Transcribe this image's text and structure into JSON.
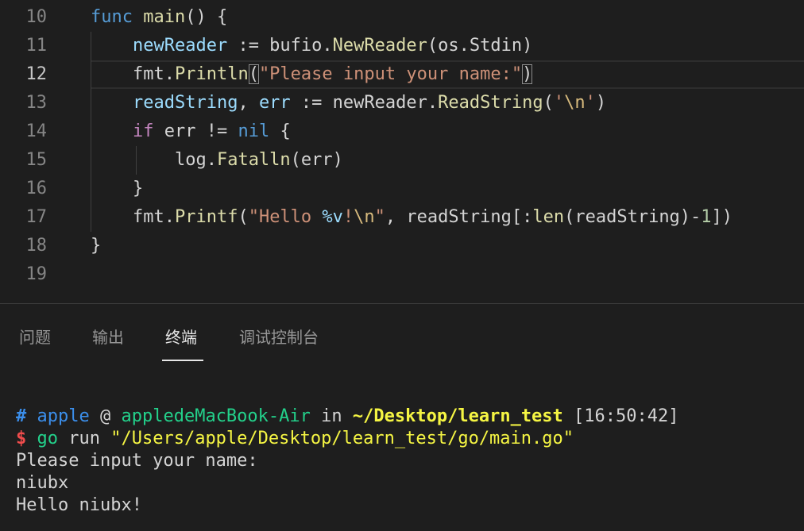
{
  "editor": {
    "lines": [
      {
        "num": "10",
        "indent": "",
        "tokens": [
          {
            "t": "func",
            "c": "#569cd6"
          },
          {
            "t": " ",
            "c": "#d4d4d4"
          },
          {
            "t": "main",
            "c": "#dcdcaa"
          },
          {
            "t": "() {",
            "c": "#d4d4d4"
          }
        ]
      },
      {
        "num": "11",
        "indent": "    ",
        "tokens": [
          {
            "t": "newReader",
            "c": "#9cdcfe"
          },
          {
            "t": " := bufio.",
            "c": "#d4d4d4"
          },
          {
            "t": "NewReader",
            "c": "#dcdcaa"
          },
          {
            "t": "(os.Stdin)",
            "c": "#d4d4d4"
          }
        ]
      },
      {
        "num": "12",
        "indent": "    ",
        "current": true,
        "tokens": [
          {
            "t": "fmt.",
            "c": "#d4d4d4"
          },
          {
            "t": "Println",
            "c": "#dcdcaa"
          },
          {
            "t": "(",
            "c": "#d4d4d4",
            "box": true
          },
          {
            "t": "\"Please input your name:\"",
            "c": "#ce9178"
          },
          {
            "t": ")",
            "c": "#d4d4d4",
            "box": true
          }
        ]
      },
      {
        "num": "13",
        "indent": "    ",
        "tokens": [
          {
            "t": "readString",
            "c": "#9cdcfe"
          },
          {
            "t": ", ",
            "c": "#d4d4d4"
          },
          {
            "t": "err",
            "c": "#9cdcfe"
          },
          {
            "t": " := newReader.",
            "c": "#d4d4d4"
          },
          {
            "t": "ReadString",
            "c": "#dcdcaa"
          },
          {
            "t": "(",
            "c": "#d4d4d4"
          },
          {
            "t": "'",
            "c": "#ce9178"
          },
          {
            "t": "\\n",
            "c": "#d7ba7d"
          },
          {
            "t": "'",
            "c": "#ce9178"
          },
          {
            "t": ")",
            "c": "#d4d4d4"
          }
        ]
      },
      {
        "num": "14",
        "indent": "    ",
        "tokens": [
          {
            "t": "if",
            "c": "#c586c0"
          },
          {
            "t": " err != ",
            "c": "#d4d4d4"
          },
          {
            "t": "nil",
            "c": "#569cd6"
          },
          {
            "t": " {",
            "c": "#d4d4d4"
          }
        ]
      },
      {
        "num": "15",
        "indent": "        ",
        "tokens": [
          {
            "t": "log.",
            "c": "#d4d4d4"
          },
          {
            "t": "Fatalln",
            "c": "#dcdcaa"
          },
          {
            "t": "(err)",
            "c": "#d4d4d4"
          }
        ]
      },
      {
        "num": "16",
        "indent": "    ",
        "tokens": [
          {
            "t": "}",
            "c": "#d4d4d4"
          }
        ]
      },
      {
        "num": "17",
        "indent": "    ",
        "tokens": [
          {
            "t": "fmt.",
            "c": "#d4d4d4"
          },
          {
            "t": "Printf",
            "c": "#dcdcaa"
          },
          {
            "t": "(",
            "c": "#d4d4d4"
          },
          {
            "t": "\"Hello ",
            "c": "#ce9178"
          },
          {
            "t": "%v",
            "c": "#9cdcfe"
          },
          {
            "t": "!",
            "c": "#ce9178"
          },
          {
            "t": "\\n",
            "c": "#d7ba7d"
          },
          {
            "t": "\"",
            "c": "#ce9178"
          },
          {
            "t": ", readString[:",
            "c": "#d4d4d4"
          },
          {
            "t": "len",
            "c": "#dcdcaa"
          },
          {
            "t": "(readString)-",
            "c": "#d4d4d4"
          },
          {
            "t": "1",
            "c": "#b5cea8"
          },
          {
            "t": "])",
            "c": "#d4d4d4"
          }
        ]
      },
      {
        "num": "18",
        "indent": "",
        "tokens": [
          {
            "t": "}",
            "c": "#d4d4d4"
          }
        ]
      },
      {
        "num": "19",
        "indent": "",
        "tokens": []
      }
    ]
  },
  "panel": {
    "tabs": [
      {
        "label": "问题",
        "active": false
      },
      {
        "label": "输出",
        "active": false
      },
      {
        "label": "终端",
        "active": true
      },
      {
        "label": "调试控制台",
        "active": false
      }
    ]
  },
  "terminal": {
    "lines": [
      [
        {
          "t": "#",
          "c": "#3b8eea",
          "bold": true
        },
        {
          "t": " ",
          "c": "#d4d4d4"
        },
        {
          "t": "apple",
          "c": "#3b8eea"
        },
        {
          "t": " @ ",
          "c": "#d4d4d4"
        },
        {
          "t": "appledeMacBook-Air",
          "c": "#23d18b"
        },
        {
          "t": " in ",
          "c": "#d4d4d4"
        },
        {
          "t": "~/Desktop/learn_test",
          "c": "#f5f543",
          "bold": true
        },
        {
          "t": " [16:50:42]",
          "c": "#d4d4d4"
        }
      ],
      [
        {
          "t": "$",
          "c": "#f14c4c",
          "bold": true
        },
        {
          "t": " ",
          "c": "#d4d4d4"
        },
        {
          "t": "go",
          "c": "#23d18b"
        },
        {
          "t": " run ",
          "c": "#d4d4d4"
        },
        {
          "t": "\"/Users/apple/Desktop/learn_test/go/main.go\"",
          "c": "#f5f543"
        }
      ],
      [
        {
          "t": "Please input your name:",
          "c": "#d4d4d4"
        }
      ],
      [
        {
          "t": "niubx",
          "c": "#d4d4d4"
        }
      ],
      [
        {
          "t": "Hello niubx!",
          "c": "#d4d4d4"
        }
      ]
    ]
  }
}
